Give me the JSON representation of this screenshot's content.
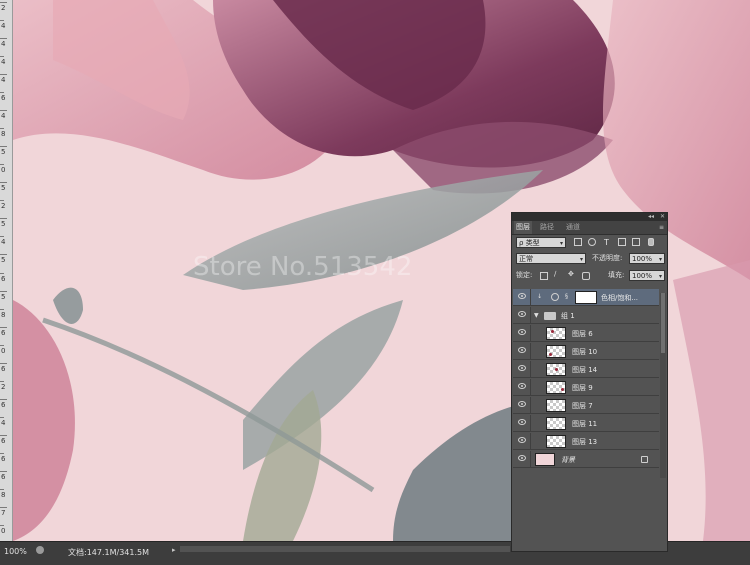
{
  "ruler": {
    "labels": [
      "2",
      "4",
      "4",
      "4",
      "4",
      "6",
      "4",
      "8",
      "5",
      "0",
      "5",
      "2",
      "5",
      "4",
      "5",
      "6",
      "5",
      "8",
      "6",
      "0",
      "6",
      "2",
      "6",
      "4",
      "6",
      "6",
      "6",
      "8",
      "7",
      "0"
    ]
  },
  "canvas": {
    "watermark": "Store No.513542",
    "background": "#f1d6d9"
  },
  "status": {
    "zoom": "100%",
    "doc_info": "文档:147.1M/341.5M",
    "arrow": "▸"
  },
  "panel": {
    "collapse": "◂◂",
    "close": "✕",
    "tabs": [
      {
        "label": "图层"
      },
      {
        "label": "路径"
      },
      {
        "label": "通道"
      }
    ],
    "menu": "≡",
    "filter": {
      "value": "类型",
      "prefix": "ρ"
    },
    "blend_mode": "正常",
    "opacity_label": "不透明度:",
    "opacity_value": "100%",
    "lock_label": "锁定:",
    "fill_label": "填充:",
    "fill_value": "100%",
    "adjustment_layer": {
      "name": "色相/饱和..."
    },
    "group": {
      "name": "组 1"
    },
    "layers": [
      {
        "name": "图层 6"
      },
      {
        "name": "图层 10"
      },
      {
        "name": "图层 14"
      },
      {
        "name": "图层 9"
      },
      {
        "name": "图层 7"
      },
      {
        "name": "图层 11"
      },
      {
        "name": "图层 13"
      }
    ],
    "background_layer": {
      "name": "背景"
    }
  },
  "colors": {
    "panel_bg": "#535353",
    "selected": "#5e6b7d",
    "petal": "#8e4a69"
  }
}
